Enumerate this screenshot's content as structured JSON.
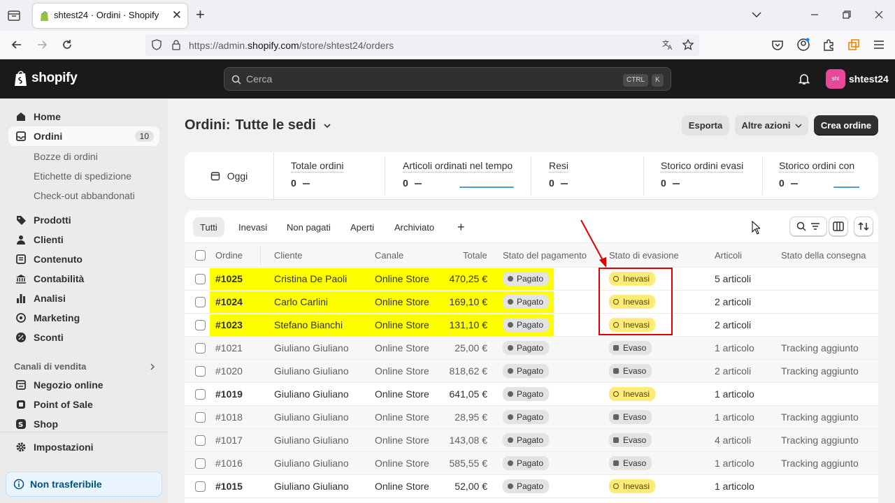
{
  "browser": {
    "tab_title": "shtest24 · Ordini · Shopify",
    "url_prefix": "https://admin.",
    "url_domain": "shopify.com",
    "url_path": "/store/shtest24/orders"
  },
  "topbar": {
    "logo_text": "shopify",
    "search_placeholder": "Cerca",
    "kbd_ctrl": "CTRL",
    "kbd_k": "K",
    "store_avatar": "sht",
    "store_name": "shtest24"
  },
  "sidebar": {
    "home": "Home",
    "orders": "Ordini",
    "orders_count": "10",
    "orders_sub": [
      "Bozze di ordini",
      "Etichette di spedizione",
      "Check-out abbandonati"
    ],
    "products": "Prodotti",
    "customers": "Clienti",
    "content": "Contenuto",
    "accounting": "Contabilità",
    "analytics": "Analisi",
    "marketing": "Marketing",
    "discounts": "Sconti",
    "sales_channels": "Canali di vendita",
    "online_store": "Negozio online",
    "pos": "Point of Sale",
    "shop": "Shop",
    "settings": "Impostazioni",
    "banner": "Non trasferibile"
  },
  "page": {
    "title_prefix": "Ordini:",
    "title_location": "Tutte le sedi",
    "export": "Esporta",
    "more_actions": "Altre azioni",
    "create_order": "Crea ordine"
  },
  "metrics": {
    "date": "Oggi",
    "items": [
      {
        "title": "Totale ordini",
        "value": "0"
      },
      {
        "title": "Articoli ordinati nel tempo",
        "value": "0"
      },
      {
        "title": "Resi",
        "value": "0"
      },
      {
        "title": "Storico ordini evasi",
        "value": "0"
      },
      {
        "title": "Storico ordini con",
        "value": "0"
      }
    ]
  },
  "filters": {
    "tabs": [
      "Tutti",
      "Inevasi",
      "Non pagati",
      "Aperti",
      "Archiviato"
    ],
    "add": "+"
  },
  "table": {
    "headers": [
      "Ordine",
      "Cliente",
      "Canale",
      "Totale",
      "Stato del pagamento",
      "Stato di evasione",
      "Articoli",
      "Stato della consegna"
    ],
    "rows": [
      {
        "order": "#1025",
        "customer": "Cristina De Paoli",
        "channel": "Online Store",
        "total": "470,25 €",
        "payment": "Pagato",
        "fulfillment": "Inevasi",
        "items": "5 articoli",
        "delivery": ""
      },
      {
        "order": "#1024",
        "customer": "Carlo Carlini",
        "channel": "Online Store",
        "total": "169,10 €",
        "payment": "Pagato",
        "fulfillment": "Inevasi",
        "items": "2 articoli",
        "delivery": ""
      },
      {
        "order": "#1023",
        "customer": "Stefano Bianchi",
        "channel": "Online Store",
        "total": "131,10 €",
        "payment": "Pagato",
        "fulfillment": "Inevasi",
        "items": "2 articoli",
        "delivery": ""
      },
      {
        "order": "#1021",
        "customer": "Giuliano Giuliano",
        "channel": "Online Store",
        "total": "25,00 €",
        "payment": "Pagato",
        "fulfillment": "Evaso",
        "items": "1 articolo",
        "delivery": "Tracking aggiunto"
      },
      {
        "order": "#1020",
        "customer": "Giuliano Giuliano",
        "channel": "Online Store",
        "total": "818,62 €",
        "payment": "Pagato",
        "fulfillment": "Evaso",
        "items": "2 articoli",
        "delivery": "Tracking aggiunto"
      },
      {
        "order": "#1019",
        "customer": "Giuliano Giuliano",
        "channel": "Online Store",
        "total": "641,05 €",
        "payment": "Pagato",
        "fulfillment": "Inevasi",
        "items": "1 articolo",
        "delivery": ""
      },
      {
        "order": "#1018",
        "customer": "Giuliano Giuliano",
        "channel": "Online Store",
        "total": "28,95 €",
        "payment": "Pagato",
        "fulfillment": "Evaso",
        "items": "1 articolo",
        "delivery": "Tracking aggiunto"
      },
      {
        "order": "#1017",
        "customer": "Giuliano Giuliano",
        "channel": "Online Store",
        "total": "143,08 €",
        "payment": "Pagato",
        "fulfillment": "Evaso",
        "items": "4 articoli",
        "delivery": "Tracking aggiunto"
      },
      {
        "order": "#1016",
        "customer": "Giuliano Giuliano",
        "channel": "Online Store",
        "total": "585,55 €",
        "payment": "Pagato",
        "fulfillment": "Evaso",
        "items": "1 articolo",
        "delivery": "Tracking aggiunto"
      },
      {
        "order": "#1015",
        "customer": "Giuliano Giuliano",
        "channel": "Online Store",
        "total": "52,00 €",
        "payment": "Pagato",
        "fulfillment": "Inevasi",
        "items": "1 articolo",
        "delivery": ""
      }
    ]
  },
  "colors": {
    "highlight": "#ffff00",
    "annotation": "#e00000",
    "unfulfilled_badge": "#ffeb78"
  }
}
